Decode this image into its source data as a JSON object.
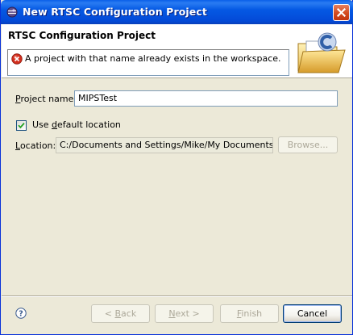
{
  "window": {
    "title": "New RTSC Configuration Project"
  },
  "header": {
    "title": "RTSC Configuration Project",
    "error_message": "A project with that name already exists in the workspace."
  },
  "form": {
    "project_name_label_prefix": "",
    "project_name_label_mnemonic": "P",
    "project_name_label_rest": "roject name:",
    "project_name_value": "MIPSTest",
    "use_default_location_checked": true,
    "use_default_label_prefix": "Use ",
    "use_default_label_mnemonic": "d",
    "use_default_label_rest": "efault location",
    "location_label_prefix": "",
    "location_label_mnemonic": "L",
    "location_label_rest": "ocation:",
    "location_value": "C:/Documents and Settings/Mike/My Documents/TI Wo",
    "browse_label": "Browse..."
  },
  "buttons": {
    "back_label": "< Back",
    "back_prefix": "< ",
    "back_mnemonic": "B",
    "back_rest": "ack",
    "next_prefix": "",
    "next_mnemonic": "N",
    "next_rest": "ext >",
    "finish_prefix": "",
    "finish_mnemonic": "F",
    "finish_rest": "inish",
    "cancel_label": "Cancel"
  },
  "icons": {
    "title": "eclipse-icon",
    "close": "close-icon",
    "error": "error-icon",
    "banner": "folder-wizard-icon",
    "help": "help-icon",
    "check": "checkmark-icon"
  },
  "colors": {
    "titlebar": "#0559e4",
    "dialog_bg": "#ece9d8",
    "error_red": "#d32f1e",
    "default_button_border": "#003c74"
  }
}
